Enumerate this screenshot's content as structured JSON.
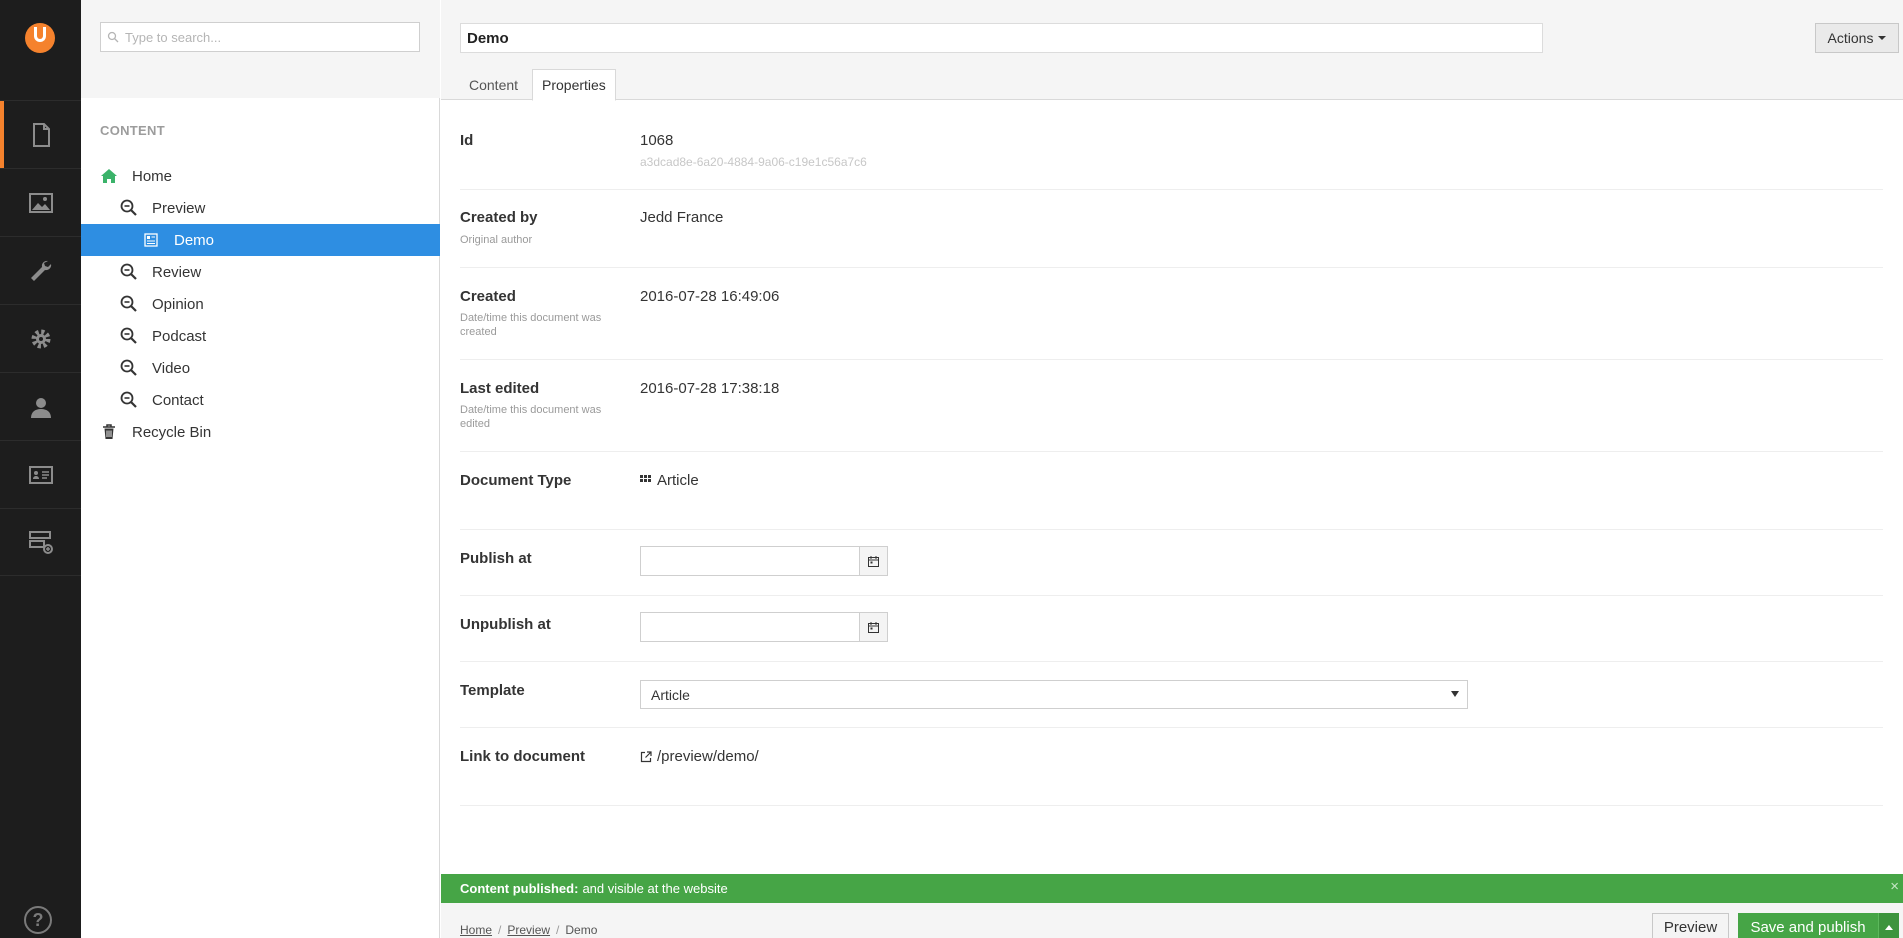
{
  "search": {
    "placeholder": "Type to search..."
  },
  "sections": [
    {
      "icon": "document-icon"
    },
    {
      "icon": "image-icon"
    },
    {
      "icon": "wrench-icon"
    },
    {
      "icon": "gear-icon"
    },
    {
      "icon": "user-icon"
    },
    {
      "icon": "member-card-icon"
    },
    {
      "icon": "forms-icon"
    }
  ],
  "tree": {
    "title": "CONTENT",
    "nodes": [
      {
        "label": "Home",
        "icon": "home-icon",
        "level": 0
      },
      {
        "label": "Preview",
        "icon": "zoom-out-icon",
        "level": 1
      },
      {
        "label": "Demo",
        "icon": "article-icon",
        "level": 2,
        "selected": true
      },
      {
        "label": "Review",
        "icon": "zoom-out-icon",
        "level": 1
      },
      {
        "label": "Opinion",
        "icon": "zoom-out-icon",
        "level": 1
      },
      {
        "label": "Podcast",
        "icon": "zoom-out-icon",
        "level": 1
      },
      {
        "label": "Video",
        "icon": "zoom-out-icon",
        "level": 1
      },
      {
        "label": "Contact",
        "icon": "zoom-out-icon",
        "level": 1
      },
      {
        "label": "Recycle Bin",
        "icon": "trash-icon",
        "level": 0
      }
    ]
  },
  "editor": {
    "name": "Demo",
    "actions_label": "Actions",
    "tabs": [
      "Content",
      "Properties"
    ],
    "active_tab": "Properties"
  },
  "properties": {
    "id": {
      "label": "Id",
      "value": "1068",
      "guid": "a3dcad8e-6a20-4884-9a06-c19e1c56a7c6"
    },
    "created_by": {
      "label": "Created by",
      "desc": "Original author",
      "value": "Jedd France"
    },
    "created": {
      "label": "Created",
      "desc": "Date/time this document was created",
      "value": "2016-07-28 16:49:06"
    },
    "last_edited": {
      "label": "Last edited",
      "desc": "Date/time this document was edited",
      "value": "2016-07-28 17:38:18"
    },
    "doc_type": {
      "label": "Document Type",
      "value": "Article"
    },
    "publish_at": {
      "label": "Publish at",
      "value": ""
    },
    "unpublish_at": {
      "label": "Unpublish at",
      "value": ""
    },
    "template": {
      "label": "Template",
      "value": "Article"
    },
    "link": {
      "label": "Link to document",
      "value": "/preview/demo/"
    }
  },
  "notification": {
    "strong": "Content published:",
    "text": "and visible at the website",
    "close": "×"
  },
  "breadcrumb": [
    "Home",
    "Preview",
    "Demo"
  ],
  "buttons": {
    "preview": "Preview",
    "save_publish": "Save and publish"
  },
  "colors": {
    "accent": "#f5822d",
    "selected": "#2e8ee2",
    "success": "#46a546",
    "appbar": "#1d1d1d"
  }
}
